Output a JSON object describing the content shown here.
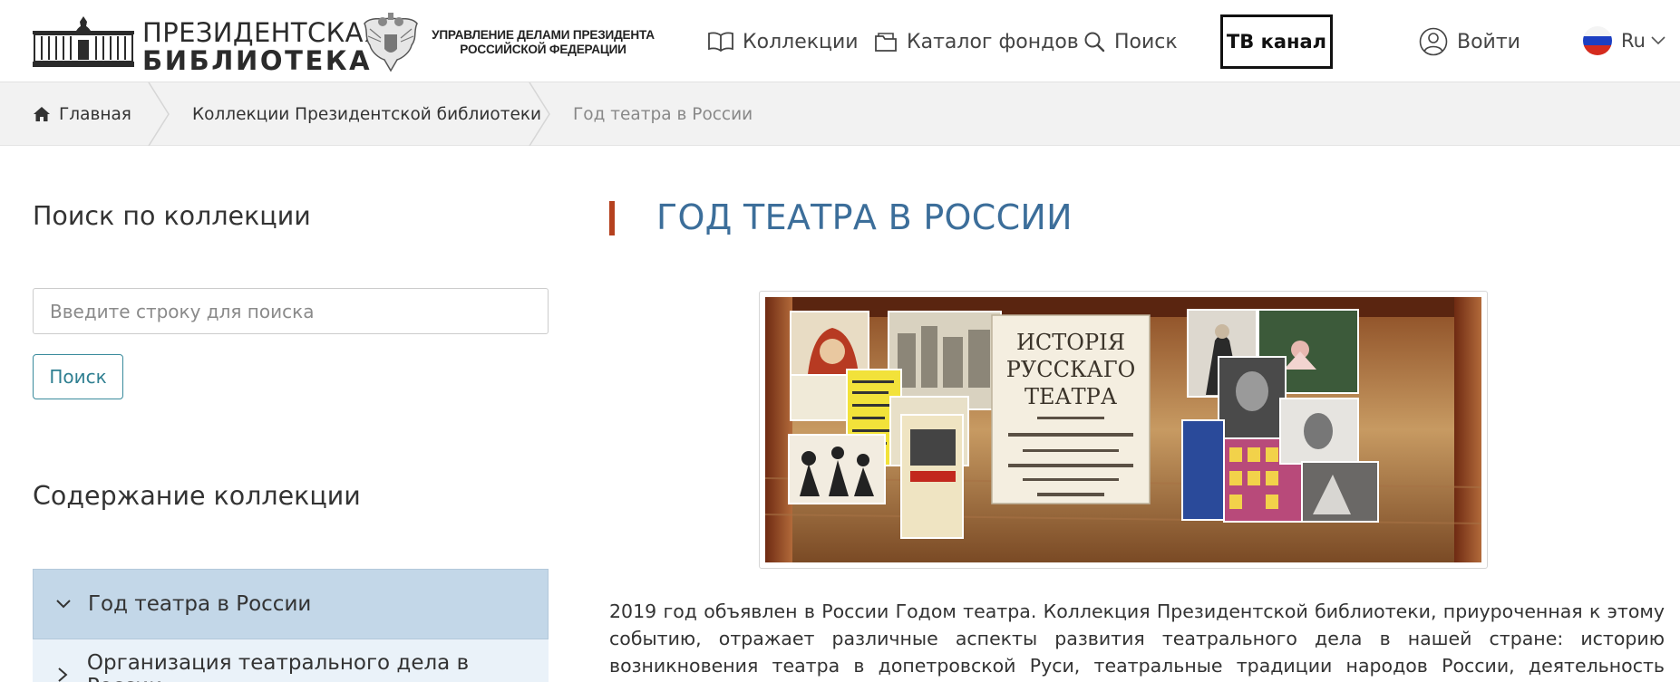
{
  "header": {
    "logo_line1": "ПРЕЗИДЕНТСКАЯ",
    "logo_line2": "БИБЛИОТЕКА",
    "admin_line1": "УПРАВЛЕНИЕ ДЕЛАМИ ПРЕЗИДЕНТА",
    "admin_line2": "РОССИЙСКОЙ ФЕДЕРАЦИИ",
    "nav": {
      "collections": "Коллекции",
      "catalog": "Каталог фондов",
      "search": "Поиск",
      "tv": "ТВ канал",
      "login": "Войти",
      "lang": "Ru"
    }
  },
  "breadcrumb": {
    "home": "Главная",
    "collections": "Коллекции Президентской библиотеки",
    "current": "Год театра в России"
  },
  "sidebar": {
    "search_title": "Поиск по коллекции",
    "search_placeholder": "Введите строку для поиска",
    "search_button": "Поиск",
    "contents_title": "Содержание коллекции",
    "items": [
      {
        "label": "Год театра в России",
        "expanded": true
      },
      {
        "label": "Организация театрального дела в России",
        "expanded": false
      }
    ]
  },
  "main": {
    "title": "ГОД ТЕАТРА В РОССИИ",
    "banner_book_lines": [
      "ИСТОРІЯ",
      "РУССКАГО",
      "ТЕАТРА"
    ],
    "intro": "2019 год объявлен в России Годом театра. Коллекция Президентской библиотеки, приуроченная к этому событию, отражает различные аспекты развития театрального дела в нашей стране: историю возникновения театра в допетровской Руси, театральные традиции народов России, деятельность органов по управлению"
  },
  "colors": {
    "accent_title": "#3c6e9a",
    "title_marker": "#b5411f",
    "tree_active_bg": "#c3d7e8",
    "tree_bg": "#eaf2f9",
    "search_button": "#2f7f91"
  }
}
